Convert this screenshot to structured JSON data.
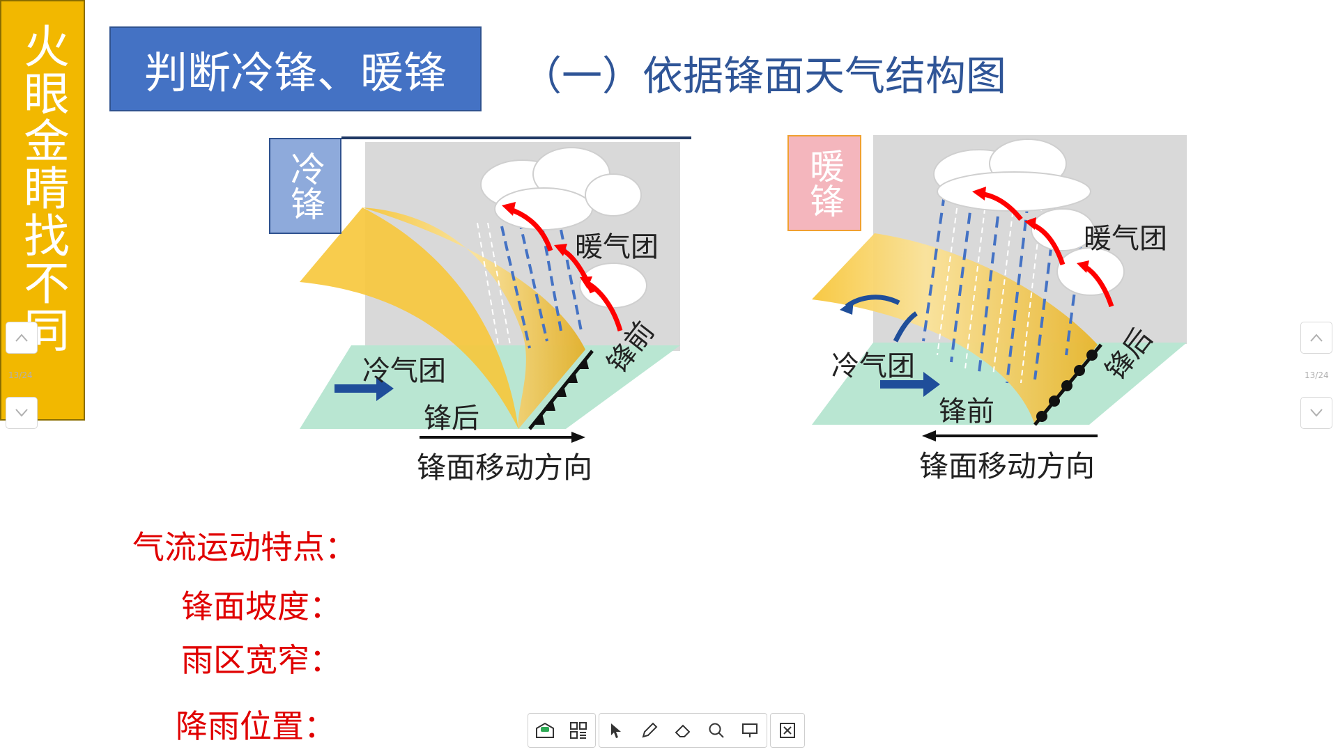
{
  "side_title": "火眼金睛找不同",
  "title": "判断冷锋、暖锋",
  "subtitle": "（一）依据锋面天气结构图",
  "cold_front": {
    "tag": "冷锋",
    "warm_mass": "暖气团",
    "cold_mass": "冷气团",
    "front_side": "锋前",
    "back_side": "锋后",
    "direction": "锋面移动方向"
  },
  "warm_front": {
    "tag": "暖锋",
    "warm_mass": "暖气团",
    "cold_mass": "冷气团",
    "front_side": "锋前",
    "back_side": "锋后",
    "direction": "锋面移动方向"
  },
  "questions": {
    "airflow": "气流运动特点：",
    "slope": "锋面坡度：",
    "rain_width": "雨区宽窄：",
    "rain_position": "降雨位置："
  },
  "nav": {
    "page_indicator": "13/24"
  },
  "toolbar": {
    "icons": [
      "message-icon",
      "grid-icon",
      "pointer-icon",
      "pen-icon",
      "eraser-icon",
      "magnifier-icon",
      "presentation-icon",
      "exit-icon"
    ]
  },
  "colors": {
    "side_bar": "#f2b800",
    "title_box": "#4472c4",
    "subtitle": "#2f5597",
    "question_text": "#e00000",
    "ground": "#b9e6d2",
    "front_surface": "#f0c030",
    "sky": "#d9d9d9",
    "warm_arrow": "#ff0000",
    "cold_arrow": "#1f4e9a",
    "rain": "#4472c4"
  }
}
